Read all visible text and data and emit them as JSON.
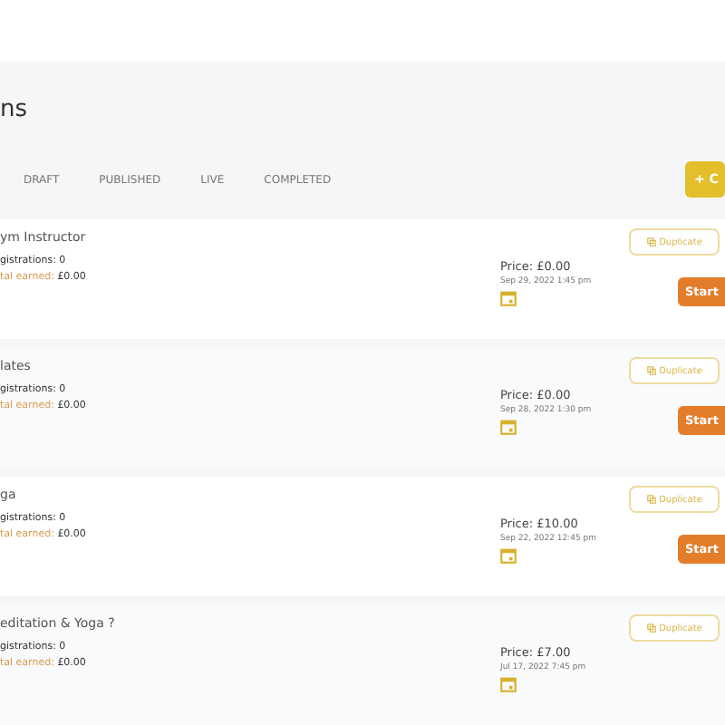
{
  "page_title": "ns",
  "tabs": [
    {
      "label": "DRAFT",
      "selected": false
    },
    {
      "label": "PUBLISHED",
      "selected": false
    },
    {
      "label": "LIVE",
      "selected": false
    },
    {
      "label": "COMPLETED",
      "selected": false
    }
  ],
  "create_button": "+ C",
  "sessions": [
    {
      "title": "ym Instructor",
      "registrations": "gistrations: 0",
      "earned_label": "tal earned:",
      "earned": "£0.00",
      "price": "Price: £0.00",
      "date": "Sep 29, 2022 1:45 pm",
      "duplicate": "Duplicate",
      "start": "Start"
    },
    {
      "title": "lates",
      "registrations": "gistrations: 0",
      "earned_label": "tal earned:",
      "earned": "£0.00",
      "price": "Price: £0.00",
      "date": "Sep 28, 2022 1:30 pm",
      "duplicate": "Duplicate",
      "start": "Start"
    },
    {
      "title": "ga",
      "registrations": "gistrations: 0",
      "earned_label": "tal earned:",
      "earned": "£0.00",
      "price": "Price: £10.00",
      "date": "Sep 22, 2022 12:45 pm",
      "duplicate": "Duplicate",
      "start": "Start"
    },
    {
      "title": "editation & Yoga ?",
      "registrations": "gistrations: 0",
      "earned_label": "tal earned:",
      "earned": "£0.00",
      "price": "Price: £7.00",
      "date": "Jul 17, 2022 7:45 pm",
      "duplicate": "Duplicate"
    }
  ]
}
